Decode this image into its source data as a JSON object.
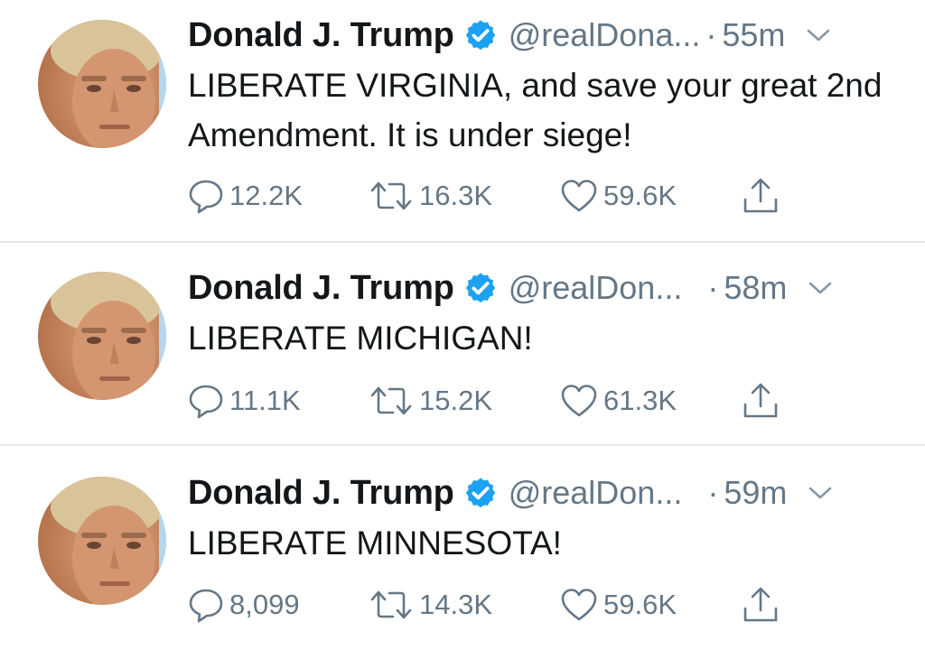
{
  "tweets": [
    {
      "name": "Donald J. Trump",
      "handle": "@realDona...",
      "dot": "·",
      "time": "55m",
      "text": "LIBERATE VIRGINIA, and save your great 2nd Amendment. It is under siege!",
      "replies": "12.2K",
      "retweets": "16.3K",
      "likes": "59.6K"
    },
    {
      "name": "Donald J. Trump",
      "handle": "@realDon...",
      "dot": "·",
      "time": "58m",
      "text": "LIBERATE MICHIGAN!",
      "replies": "11.1K",
      "retweets": "15.2K",
      "likes": "61.3K"
    },
    {
      "name": "Donald J. Trump",
      "handle": "@realDon...",
      "dot": "·",
      "time": "59m",
      "text": "LIBERATE MINNESOTA!",
      "replies": "8,099",
      "retweets": "14.3K",
      "likes": "59.6K"
    }
  ],
  "icons": {
    "verified": "verified-badge-icon",
    "chevron": "chevron-down-icon",
    "reply": "reply-bubble-icon",
    "retweet": "retweet-icon",
    "like": "heart-icon",
    "share": "share-upload-icon"
  },
  "colors": {
    "text": "#14171a",
    "secondary": "#657786",
    "verified": "#1da1f2",
    "divider": "#e1e8ed"
  }
}
